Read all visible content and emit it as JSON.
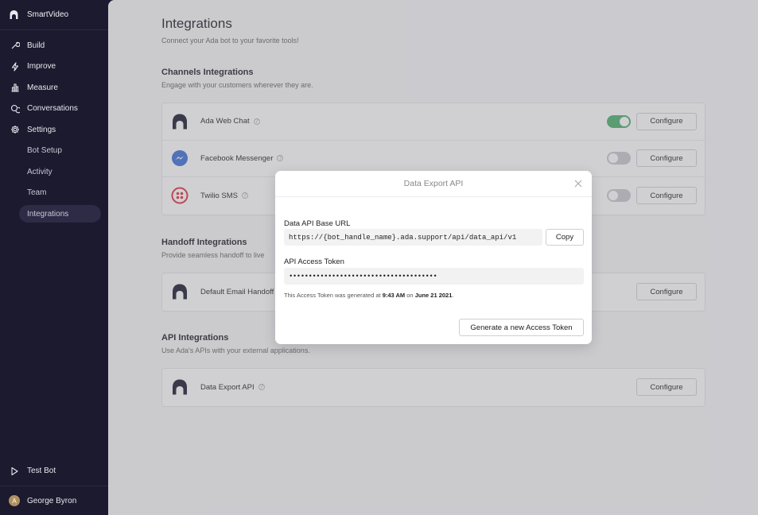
{
  "app": {
    "name": "SmartVideo"
  },
  "sidebar": {
    "items": [
      {
        "label": "Build",
        "icon": "wrench-icon"
      },
      {
        "label": "Improve",
        "icon": "lightning-icon"
      },
      {
        "label": "Measure",
        "icon": "bar-chart-icon"
      },
      {
        "label": "Conversations",
        "icon": "chat-icon"
      },
      {
        "label": "Settings",
        "icon": "gear-icon"
      }
    ],
    "sub_items": [
      {
        "label": "Bot Setup"
      },
      {
        "label": "Activity"
      },
      {
        "label": "Team"
      },
      {
        "label": "Integrations",
        "active": true
      }
    ],
    "test_bot": "Test Bot",
    "user": {
      "initial": "A",
      "name": "George Byron"
    }
  },
  "page": {
    "title": "Integrations",
    "subtitle": "Connect your Ada bot to your favorite tools!"
  },
  "channels": {
    "title": "Channels Integrations",
    "subtitle": "Engage with your customers wherever they are.",
    "rows": [
      {
        "label": "Ada Web Chat",
        "toggle": true,
        "configure": "Configure"
      },
      {
        "label": "Facebook Messenger",
        "toggle": false,
        "configure": "Configure"
      },
      {
        "label": "Twilio SMS",
        "toggle": false,
        "configure": "Configure"
      }
    ]
  },
  "handoff": {
    "title": "Handoff Integrations",
    "subtitle": "Provide seamless handoff to live",
    "rows": [
      {
        "label": "Default Email Handoff",
        "configure": "Configure"
      }
    ]
  },
  "api": {
    "title": "API Integrations",
    "subtitle": "Use Ada's APIs with your external applications.",
    "rows": [
      {
        "label": "Data Export API",
        "configure": "Configure"
      }
    ]
  },
  "modal": {
    "title": "Data Export API",
    "base_url_label": "Data API Base URL",
    "base_url_value": "https://{bot_handle_name}.ada.support/api/data_api/v1",
    "copy_label": "Copy",
    "token_label": "API Access Token",
    "token_value": "••••••••••••••••••••••••••••••••••••••",
    "note_prefix": "This Access Token was generated at ",
    "note_time": "9:43 AM",
    "note_mid": " on ",
    "note_date": "June 21 2021",
    "note_suffix": ".",
    "generate_label": "Generate a new Access Token"
  },
  "colors": {
    "sidebar_bg": "#1b1a2e",
    "toggle_on": "#4caf6a",
    "messenger_blue": "#3b6fd8",
    "twilio_red": "#e0313f"
  }
}
